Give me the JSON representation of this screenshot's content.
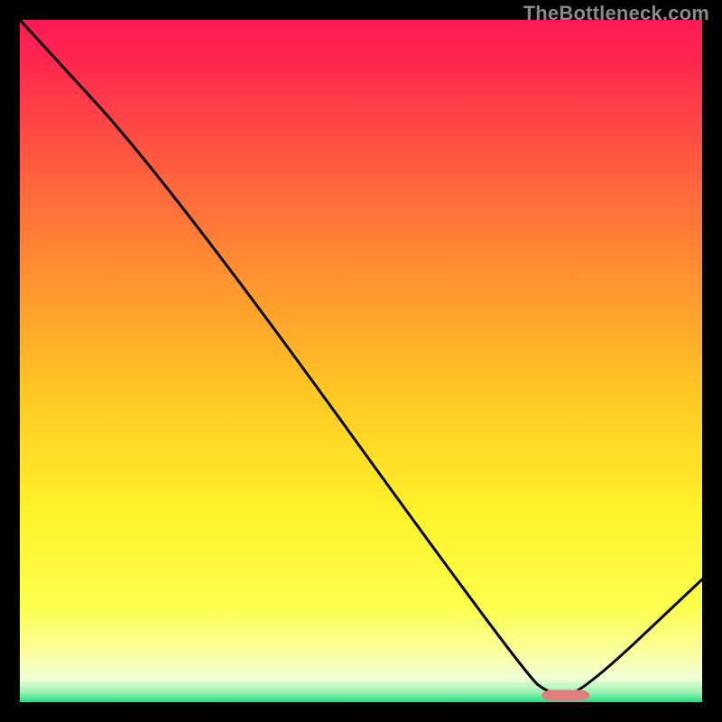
{
  "watermark": "TheBottleneck.com",
  "chart_data": {
    "type": "line",
    "title": "",
    "xlabel": "",
    "ylabel": "",
    "xlim": [
      0,
      100
    ],
    "ylim": [
      0,
      100
    ],
    "grid": false,
    "legend": false,
    "series": [
      {
        "name": "curve",
        "x": [
          0,
          22,
          74,
          78,
          82,
          100
        ],
        "values": [
          100,
          76,
          4,
          1,
          1,
          18
        ]
      }
    ],
    "marker": {
      "name": "optimum-marker",
      "x": 80,
      "y": 1,
      "color": "#e17e81",
      "width": 7,
      "height": 1.6,
      "rx": 1.5
    },
    "gradient_stops": [
      {
        "pos": 0.0,
        "top_color": "#ff1a53"
      },
      {
        "pos": 0.05,
        "top_color": "#ff2350"
      },
      {
        "pos": 0.2,
        "top_color": "#ff5740"
      },
      {
        "pos": 0.4,
        "top_color": "#ff9a2f"
      },
      {
        "pos": 0.55,
        "top_color": "#ffc824"
      },
      {
        "pos": 0.72,
        "top_color": "#fff22a"
      },
      {
        "pos": 0.86,
        "top_color": "#fcff4c"
      },
      {
        "pos": 0.93,
        "top_color": "#faffa2"
      },
      {
        "pos": 0.965,
        "top_color": "#f1ffd4"
      },
      {
        "pos": 0.985,
        "top_color": "#9df4b5"
      },
      {
        "pos": 1.0,
        "top_color": "#1fe07e"
      }
    ]
  }
}
